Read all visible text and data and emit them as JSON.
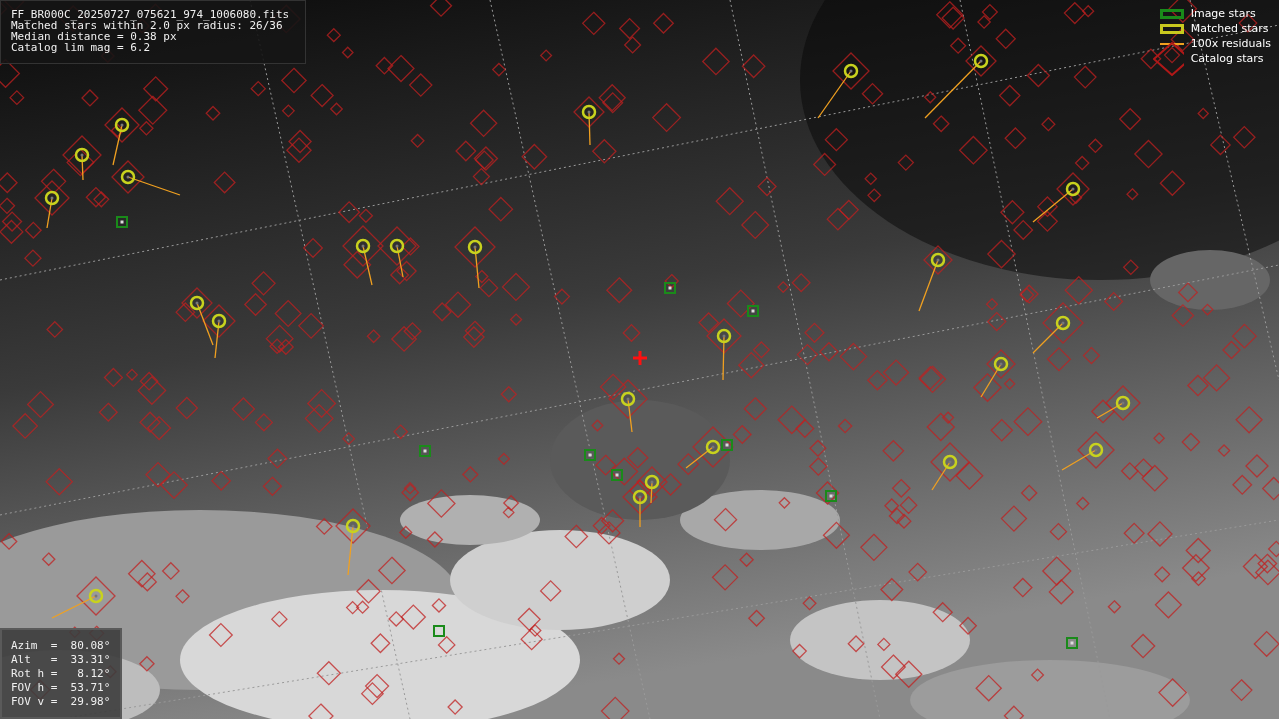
{
  "image_info": {
    "lines": [
      "FF_BR000C_20250727_075621_974_1006080.fits",
      "Matched stars within 2.0 px radius: 26/36",
      "Median distance = 0.38 px",
      "Catalog lim mag = 6.2"
    ]
  },
  "legend": [
    {
      "label": "Image stars",
      "color": "#1a8a1a"
    },
    {
      "kind": "matched",
      "label": "Matched stars",
      "color": "#c8c81e"
    },
    {
      "kind": "residual",
      "label": "100x residuals",
      "color": "#f0a020"
    },
    {
      "kind": "catalog",
      "label": "Catalog stars",
      "color": "#b01818"
    }
  ],
  "pointing": {
    "lines": [
      "Azim  =  80.08°",
      "Alt   =  33.31°",
      "Rot h =   8.12°",
      "FOV h =  53.71°",
      "FOV v =  29.98°"
    ]
  }
}
